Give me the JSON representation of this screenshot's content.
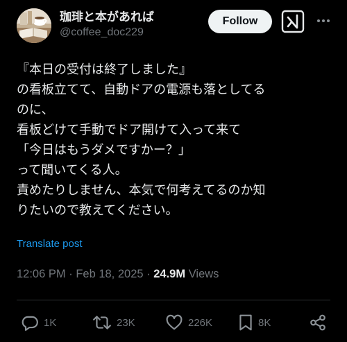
{
  "author": {
    "display_name": "珈琲と本があれば",
    "handle": "@coffee_doc229",
    "avatar_icon": "coffee-book-avatar"
  },
  "header": {
    "follow_label": "Follow",
    "grok_icon": "grok-icon",
    "more_icon": "more-icon"
  },
  "tweet": {
    "lines": [
      "『本日の受付は終了しました』",
      "の看板立てて、自動ドアの電源も落としてる",
      "のに、",
      "看板どけて手動でドア開けて入って来て",
      "「今日はもうダメですかー？」",
      "って聞いてくる人。",
      "責めたりしません、本気で何考えてるのか知",
      "りたいので教えてください。"
    ],
    "translate_label": "Translate post"
  },
  "meta": {
    "time": "12:06 PM",
    "separator": "·",
    "date": "Feb 18, 2025",
    "views_count": "24.9M",
    "views_label": "Views"
  },
  "actions": {
    "replies": "1K",
    "reposts": "23K",
    "likes": "226K",
    "bookmarks": "8K"
  },
  "colors": {
    "background": "#000000",
    "text": "#e7e9ea",
    "muted": "#71767b",
    "link": "#1d9bf0",
    "follow_bg": "#eff3f4"
  }
}
